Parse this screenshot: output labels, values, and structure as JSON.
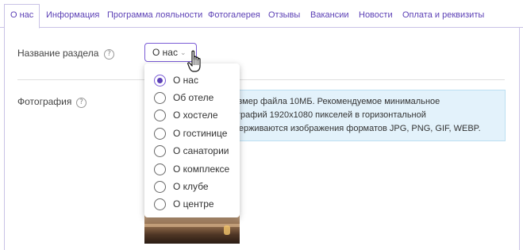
{
  "tabs": [
    {
      "label": "О нас",
      "active": true
    },
    {
      "label": "Информация"
    },
    {
      "label": "Программа лояльности"
    },
    {
      "label": "Фотогалерея"
    },
    {
      "label": "Отзывы"
    },
    {
      "label": "Вакансии"
    },
    {
      "label": "Новости"
    },
    {
      "label": "Оплата и реквизиты"
    }
  ],
  "section_name": {
    "label": "Название раздела",
    "help_icon": "?",
    "selected": "О нас",
    "options": [
      "О нас",
      "Об отеле",
      "О хостеле",
      "О гостинице",
      "О санатории",
      "О комплексе",
      "О клубе",
      "О центре"
    ],
    "selected_index": 0
  },
  "photo": {
    "label": "Фотография",
    "help_icon": "?",
    "info_lines": [
      "размер файла 10МБ. Рекомендуемое минимальное",
      "тографий 1920x1080 пикселей в горизонтальной",
      "ддерживаются изображения форматов JPG, PNG, GIF, WEBP."
    ]
  },
  "colors": {
    "accent": "#5b3fb5",
    "info_bg": "#e3f2fb",
    "border": "#c9c2e6"
  }
}
